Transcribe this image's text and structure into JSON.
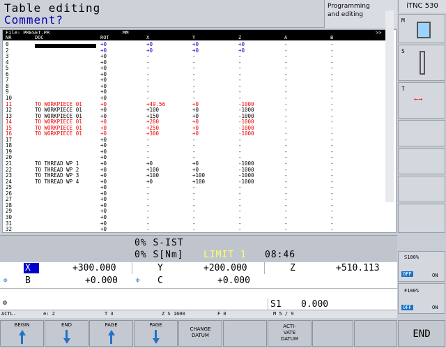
{
  "header": {
    "title": "Table editing",
    "subtitle": "Comment?",
    "mode_line1": "Programming",
    "mode_line2": "and editing",
    "control": "iTNC 530"
  },
  "table": {
    "file_label": "File: PRESET.PR",
    "unit": "MM",
    "more": ">>",
    "columns": [
      "NR",
      "DOC",
      "ROT",
      "X",
      "Y",
      "Z",
      "A",
      "B"
    ],
    "rows": [
      {
        "nr": "0",
        "doc": "",
        "rot": "+0",
        "x": "+0",
        "y": "+0",
        "z": "+0",
        "a": "-",
        "b": "-",
        "style": "blue"
      },
      {
        "nr": "2",
        "doc": "",
        "rot": "+0",
        "x": "+0",
        "y": "+0",
        "z": "+0",
        "a": "-",
        "b": "-",
        "style": "blue"
      },
      {
        "nr": "3",
        "doc": "",
        "rot": "+0",
        "x": "-",
        "y": "-",
        "z": "-",
        "a": "-",
        "b": "-"
      },
      {
        "nr": "4",
        "doc": "",
        "rot": "+0",
        "x": "-",
        "y": "-",
        "z": "-",
        "a": "-",
        "b": "-"
      },
      {
        "nr": "5",
        "doc": "",
        "rot": "+0",
        "x": "-",
        "y": "-",
        "z": "-",
        "a": "-",
        "b": "-"
      },
      {
        "nr": "6",
        "doc": "",
        "rot": "+0",
        "x": "-",
        "y": "-",
        "z": "-",
        "a": "-",
        "b": "-"
      },
      {
        "nr": "7",
        "doc": "",
        "rot": "+0",
        "x": "-",
        "y": "-",
        "z": "-",
        "a": "-",
        "b": "-"
      },
      {
        "nr": "8",
        "doc": "",
        "rot": "+0",
        "x": "-",
        "y": "-",
        "z": "-",
        "a": "-",
        "b": "-"
      },
      {
        "nr": "9",
        "doc": "",
        "rot": "+0",
        "x": "-",
        "y": "-",
        "z": "-",
        "a": "-",
        "b": "-"
      },
      {
        "nr": "10",
        "doc": "",
        "rot": "+0",
        "x": "-",
        "y": "-",
        "z": "-",
        "a": "-",
        "b": "-"
      },
      {
        "nr": "11",
        "doc": "TO WORKPIECE 01",
        "rot": "+0",
        "x": "+49.56",
        "y": "+0",
        "z": "-1000",
        "a": "-",
        "b": "-",
        "style": "red"
      },
      {
        "nr": "12",
        "doc": "TO WORKPIECE 01",
        "rot": "+0",
        "x": "+100",
        "y": "+0",
        "z": "-1000",
        "a": "-",
        "b": "-"
      },
      {
        "nr": "13",
        "doc": "TO WORKPIECE 01",
        "rot": "+0",
        "x": "+150",
        "y": "+0",
        "z": "-1000",
        "a": "-",
        "b": "-"
      },
      {
        "nr": "14",
        "doc": "TO WORKPIECE 01",
        "rot": "+0",
        "x": "+200",
        "y": "+0",
        "z": "-1000",
        "a": "-",
        "b": "-",
        "style": "red"
      },
      {
        "nr": "15",
        "doc": "TO WORKPIECE 01",
        "rot": "+0",
        "x": "+250",
        "y": "+0",
        "z": "-1000",
        "a": "-",
        "b": "-",
        "style": "red"
      },
      {
        "nr": "16",
        "doc": "TO WORKPIECE 01",
        "rot": "+0",
        "x": "+300",
        "y": "+0",
        "z": "-1000",
        "a": "-",
        "b": "-",
        "style": "red"
      },
      {
        "nr": "17",
        "doc": "",
        "rot": "+0",
        "x": "-",
        "y": "-",
        "z": "-",
        "a": "-",
        "b": "-"
      },
      {
        "nr": "18",
        "doc": "",
        "rot": "+0",
        "x": "-",
        "y": "-",
        "z": "-",
        "a": "-",
        "b": "-"
      },
      {
        "nr": "19",
        "doc": "",
        "rot": "+0",
        "x": "-",
        "y": "-",
        "z": "-",
        "a": "-",
        "b": "-"
      },
      {
        "nr": "20",
        "doc": "",
        "rot": "+0",
        "x": "-",
        "y": "-",
        "z": "-",
        "a": "-",
        "b": "-"
      },
      {
        "nr": "21",
        "doc": "TO THREAD WP 1",
        "rot": "+0",
        "x": "+0",
        "y": "+0",
        "z": "-1000",
        "a": "-",
        "b": "-"
      },
      {
        "nr": "22",
        "doc": "TO THREAD WP 2",
        "rot": "+0",
        "x": "+100",
        "y": "+0",
        "z": "-1000",
        "a": "-",
        "b": "-"
      },
      {
        "nr": "23",
        "doc": "TO THREAD WP 3",
        "rot": "+0",
        "x": "+100",
        "y": "+100",
        "z": "-1000",
        "a": "-",
        "b": "-"
      },
      {
        "nr": "24",
        "doc": "TO THREAD WP 4",
        "rot": "+0",
        "x": "+0",
        "y": "+100",
        "z": "-1000",
        "a": "-",
        "b": "-"
      },
      {
        "nr": "25",
        "doc": "",
        "rot": "+0",
        "x": "-",
        "y": "-",
        "z": "-",
        "a": "-",
        "b": "-"
      },
      {
        "nr": "26",
        "doc": "",
        "rot": "+0",
        "x": "-",
        "y": "-",
        "z": "-",
        "a": "-",
        "b": "-"
      },
      {
        "nr": "27",
        "doc": "",
        "rot": "+0",
        "x": "-",
        "y": "-",
        "z": "-",
        "a": "-",
        "b": "-"
      },
      {
        "nr": "28",
        "doc": "",
        "rot": "+0",
        "x": "-",
        "y": "-",
        "z": "-",
        "a": "-",
        "b": "-"
      },
      {
        "nr": "29",
        "doc": "",
        "rot": "+0",
        "x": "-",
        "y": "-",
        "z": "-",
        "a": "-",
        "b": "-"
      },
      {
        "nr": "30",
        "doc": "",
        "rot": "+0",
        "x": "-",
        "y": "-",
        "z": "-",
        "a": "-",
        "b": "-"
      },
      {
        "nr": "31",
        "doc": "",
        "rot": "+0",
        "x": "-",
        "y": "-",
        "z": "-",
        "a": "-",
        "b": "-"
      },
      {
        "nr": "32",
        "doc": "",
        "rot": "+0",
        "x": "-",
        "y": "-",
        "z": "-",
        "a": "-",
        "b": "-"
      }
    ]
  },
  "override": {
    "line1": "0% S-IST",
    "line2": "0% S[Nm]",
    "limit": "LIMIT 1",
    "time": "08:46"
  },
  "positions": {
    "x_label": "X",
    "x_val": "+300.000",
    "y_label": "Y",
    "y_val": "+200.000",
    "z_label": "Z",
    "z_val": "+510.113",
    "b_label": "B",
    "b_val": "+0.000",
    "c_label": "C",
    "c_val": "+0.000",
    "s_label": "S1",
    "s_val": "0.000"
  },
  "status": {
    "actl": "ACTL.",
    "dt": "⊕: 2",
    "tool": "T 3",
    "z_s": "Z S 1600",
    "feed": "F 0",
    "m": "M 5 / 9"
  },
  "softkeys": [
    {
      "label": "BEGIN",
      "arrow": "up"
    },
    {
      "label": "END",
      "arrow": "down"
    },
    {
      "label": "PAGE",
      "arrow": "up"
    },
    {
      "label": "PAGE",
      "arrow": "down"
    },
    {
      "label": "CHANGE\nDATUM",
      "arrow": ""
    },
    {
      "label": "",
      "arrow": ""
    },
    {
      "label": "ACTI-\nVATE\nDATUM",
      "arrow": ""
    },
    {
      "label": "",
      "arrow": ""
    }
  ],
  "end_key": "END",
  "right": {
    "m_label": "M",
    "s_label": "S",
    "t_label": "T",
    "s100": "S100%",
    "f100": "F100%",
    "off1": "OFF",
    "on1": "ON",
    "off2": "OFF",
    "on2": "ON"
  },
  "colors": {
    "accent": "#1e73c8",
    "red": "#e00000"
  }
}
